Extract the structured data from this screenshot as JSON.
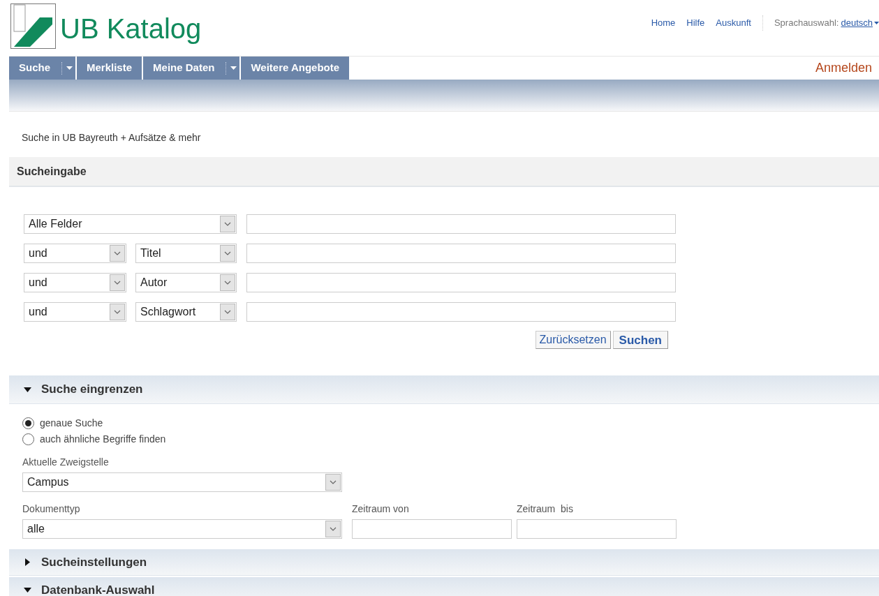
{
  "header": {
    "logo_text": "UB Katalog",
    "top_links": [
      "Home",
      "Hilfe",
      "Auskunft"
    ],
    "language": {
      "label": "Sprachauswahl:",
      "value": "deutsch"
    }
  },
  "nav": {
    "items": [
      {
        "label": "Suche",
        "dropdown": true
      },
      {
        "label": "Merkliste",
        "dropdown": false
      },
      {
        "label": "Meine Daten",
        "dropdown": true
      },
      {
        "label": "Weitere Angebote",
        "dropdown": false
      }
    ],
    "login": "Anmelden"
  },
  "scope_text": "Suche in UB Bayreuth + Aufsätze & mehr",
  "search": {
    "title": "Sucheingabe",
    "rows": [
      {
        "field": "Alle Felder"
      },
      {
        "operator": "und",
        "field": "Titel"
      },
      {
        "operator": "und",
        "field": "Autor"
      },
      {
        "operator": "und",
        "field": "Schlagwort"
      }
    ],
    "buttons": [
      {
        "label": "Zurücksetzen",
        "primary": false
      },
      {
        "label": "Suchen",
        "primary": true
      }
    ]
  },
  "refine": {
    "title": "Suche eingrenzen",
    "expanded": true,
    "match_options": [
      {
        "label": "genaue Suche",
        "selected": true
      },
      {
        "label": "auch ähnliche Begriffe finden",
        "selected": false
      }
    ],
    "branch": {
      "label": "Aktuelle Zweigstelle",
      "value": "Campus"
    },
    "doc_type": {
      "label": "Dokumenttyp",
      "value": "alle"
    },
    "date_from": {
      "label": "Zeitraum von"
    },
    "date_to": {
      "label": "Zeitraum  bis"
    }
  },
  "panels": [
    {
      "title": "Sucheinstellungen",
      "expanded": false
    },
    {
      "title": "Datenbank-Auswahl",
      "expanded": true
    }
  ]
}
